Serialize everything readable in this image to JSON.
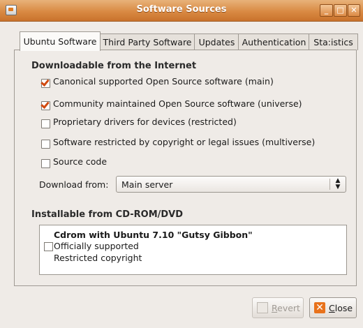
{
  "window": {
    "title": "Software Sources",
    "controls": {
      "minimize": "_",
      "maximize": "□",
      "close": "✕"
    }
  },
  "tabs": [
    {
      "label": "Ubuntu Software",
      "active": true
    },
    {
      "label": "Third Party Software",
      "active": false
    },
    {
      "label": "Updates",
      "active": false
    },
    {
      "label": "Authentication",
      "active": false
    },
    {
      "label": "Sta:istics",
      "active": false
    }
  ],
  "downloadable": {
    "header": "Downloadable from the Internet",
    "items": [
      {
        "label": "Canonical supported Open Source software (main)",
        "checked": true
      },
      {
        "label": "Community maintained Open Source software (universe)",
        "checked": true
      },
      {
        "label": "Proprietary drivers for devices (restricted)",
        "checked": false
      },
      {
        "label": "Software restricted by copyright or legal issues (multiverse)",
        "checked": false
      },
      {
        "label": "Source code",
        "checked": false
      }
    ],
    "download_from_label": "Download from:",
    "download_from_value": "Main server"
  },
  "installable": {
    "header": "Installable from CD-ROM/DVD",
    "cd_title": "Cdrom with Ubuntu 7.10 \"Gutsy Gibbon\"",
    "cd_line1": "Officially supported",
    "cd_line2": "Restricted copyright",
    "cd_checked": false
  },
  "buttons": {
    "revert_label": "evert",
    "revert_mnemonic": "R",
    "revert_enabled": false,
    "close_label": "lose",
    "close_mnemonic": "C"
  },
  "colors": {
    "titlebar": "#d98a43",
    "check_accent": "#d14a10",
    "background": "#efebe7"
  },
  "icons": {
    "app": "software-sources-icon",
    "revert": "revert-icon",
    "close": "close-x-icon"
  }
}
